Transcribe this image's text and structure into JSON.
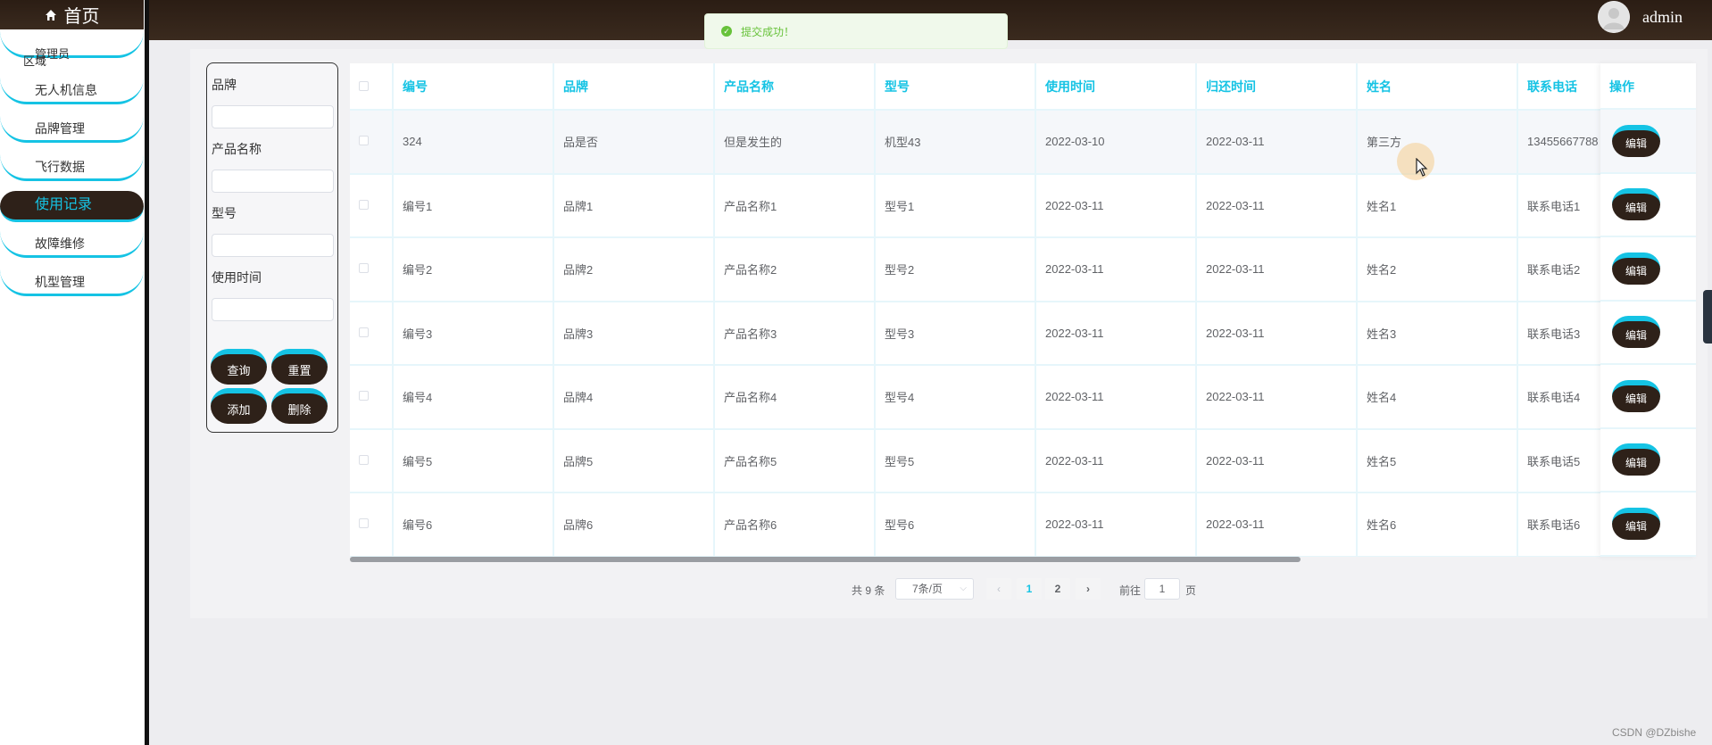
{
  "sidebar": {
    "title": "首页",
    "overlap_text_a": "管理员",
    "overlap_text_b": "区域",
    "items": [
      {
        "label": "无人机信息"
      },
      {
        "label": "品牌管理"
      },
      {
        "label": "飞行数据"
      },
      {
        "label": "使用记录",
        "active": true
      },
      {
        "label": "故障维修"
      },
      {
        "label": "机型管理"
      }
    ]
  },
  "header": {
    "username": "admin"
  },
  "toast": {
    "message": "提交成功！"
  },
  "search": {
    "labels": {
      "brand": "品牌",
      "product_name": "产品名称",
      "model": "型号",
      "use_time": "使用时间"
    },
    "buttons": {
      "query": "查询",
      "reset": "重置",
      "add": "添加",
      "delete": "删除"
    }
  },
  "table": {
    "headers": [
      "编号",
      "品牌",
      "产品名称",
      "型号",
      "使用时间",
      "归还时间",
      "姓名",
      "联系电话",
      "操作"
    ],
    "edit_label": "编辑",
    "rows": [
      [
        "324",
        "品是否",
        "但是发生的",
        "机型43",
        "2022-03-10",
        "2022-03-11",
        "第三方",
        "13455667788"
      ],
      [
        "编号1",
        "品牌1",
        "产品名称1",
        "型号1",
        "2022-03-11",
        "2022-03-11",
        "姓名1",
        "联系电话1"
      ],
      [
        "编号2",
        "品牌2",
        "产品名称2",
        "型号2",
        "2022-03-11",
        "2022-03-11",
        "姓名2",
        "联系电话2"
      ],
      [
        "编号3",
        "品牌3",
        "产品名称3",
        "型号3",
        "2022-03-11",
        "2022-03-11",
        "姓名3",
        "联系电话3"
      ],
      [
        "编号4",
        "品牌4",
        "产品名称4",
        "型号4",
        "2022-03-11",
        "2022-03-11",
        "姓名4",
        "联系电话4"
      ],
      [
        "编号5",
        "品牌5",
        "产品名称5",
        "型号5",
        "2022-03-11",
        "2022-03-11",
        "姓名5",
        "联系电话5"
      ],
      [
        "编号6",
        "品牌6",
        "产品名称6",
        "型号6",
        "2022-03-11",
        "2022-03-11",
        "姓名6",
        "联系电话6"
      ]
    ]
  },
  "pagination": {
    "total_text": "共 9 条",
    "page_size": "7条/页",
    "pages": [
      "1",
      "2"
    ],
    "current_page": "1",
    "jump_prefix": "前往",
    "jump_value": "1",
    "jump_suffix": "页"
  },
  "watermark": "CSDN @DZbishe",
  "colors": {
    "accent": "#15c3e4",
    "dark": "#2e2119",
    "success": "#67c23a"
  }
}
